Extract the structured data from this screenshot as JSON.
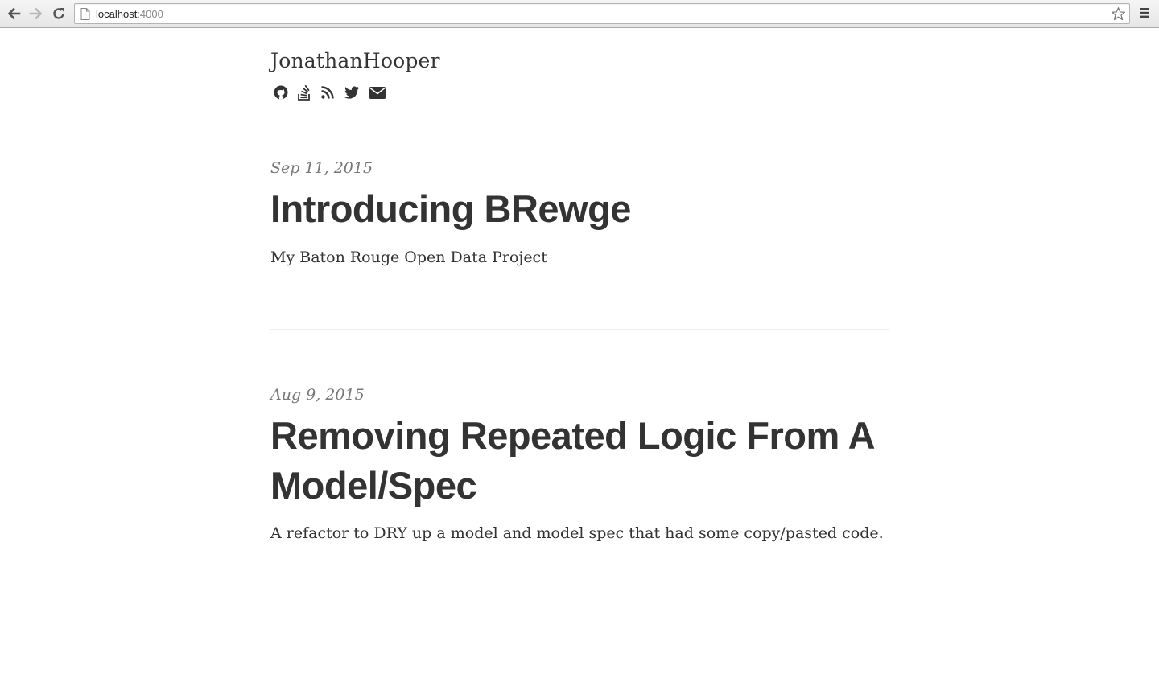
{
  "browser": {
    "url_host": "localhost",
    "url_port": ":4000",
    "icons": [
      "back-icon",
      "forward-icon",
      "reload-icon",
      "page-icon",
      "star-icon",
      "menu-icon"
    ]
  },
  "site": {
    "title": "JonathanHooper",
    "social_icons": [
      "github-icon",
      "stackoverflow-icon",
      "rss-icon",
      "twitter-icon",
      "email-icon"
    ]
  },
  "posts": [
    {
      "date": "Sep 11, 2015",
      "title": "Introducing BRewge",
      "subtitle": "My Baton Rouge Open Data Project"
    },
    {
      "date": "Aug 9, 2015",
      "title": "Removing Repeated Logic From A Model/Spec",
      "subtitle": "A refactor to DRY up a model and model spec that had some copy/pasted code."
    }
  ],
  "colors": {
    "text": "#333333",
    "date": "#777777",
    "divider": "#eeeeee"
  }
}
